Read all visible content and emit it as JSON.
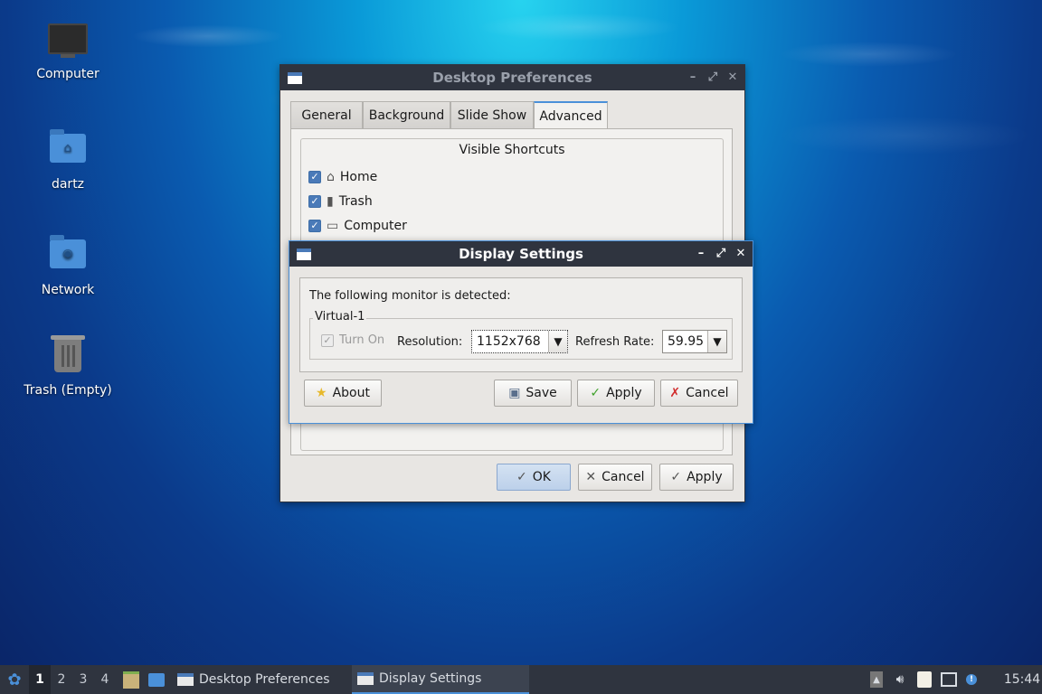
{
  "desktop": {
    "icons": [
      {
        "label": "Computer",
        "icon": "computer-icon"
      },
      {
        "label": "dartz",
        "icon": "home-folder-icon"
      },
      {
        "label": "Network",
        "icon": "network-folder-icon"
      },
      {
        "label": "Trash (Empty)",
        "icon": "trash-icon"
      }
    ]
  },
  "desktop_prefs": {
    "title": "Desktop Preferences",
    "tabs": [
      "General",
      "Background",
      "Slide Show",
      "Advanced"
    ],
    "active_tab": "Advanced",
    "section_title": "Visible Shortcuts",
    "shortcuts": [
      {
        "label": "Home",
        "checked": true,
        "icon": "home-icon"
      },
      {
        "label": "Trash",
        "checked": true,
        "icon": "trash-icon"
      },
      {
        "label": "Computer",
        "checked": true,
        "icon": "monitor-icon"
      }
    ],
    "buttons": {
      "ok": "OK",
      "cancel": "Cancel",
      "apply": "Apply"
    }
  },
  "display_settings": {
    "title": "Display Settings",
    "detected_text": "The following monitor is detected:",
    "monitor_name": "Virtual-1",
    "turn_on_label": "Turn On",
    "turn_on_checked": true,
    "resolution_label": "Resolution:",
    "resolution_value": "1152x768",
    "refresh_label": "Refresh Rate:",
    "refresh_value": "59.95",
    "buttons": {
      "about": "About",
      "save": "Save",
      "apply": "Apply",
      "cancel": "Cancel"
    }
  },
  "taskbar": {
    "workspaces": [
      "1",
      "2",
      "3",
      "4"
    ],
    "active_workspace": "1",
    "tasks": [
      {
        "label": "Desktop Preferences",
        "active": false
      },
      {
        "label": "Display Settings",
        "active": true
      }
    ],
    "clock": "15:44"
  },
  "colors": {
    "titlebar": "#2f343f",
    "accent": "#4a90d9",
    "taskbar": "#2f343f"
  }
}
